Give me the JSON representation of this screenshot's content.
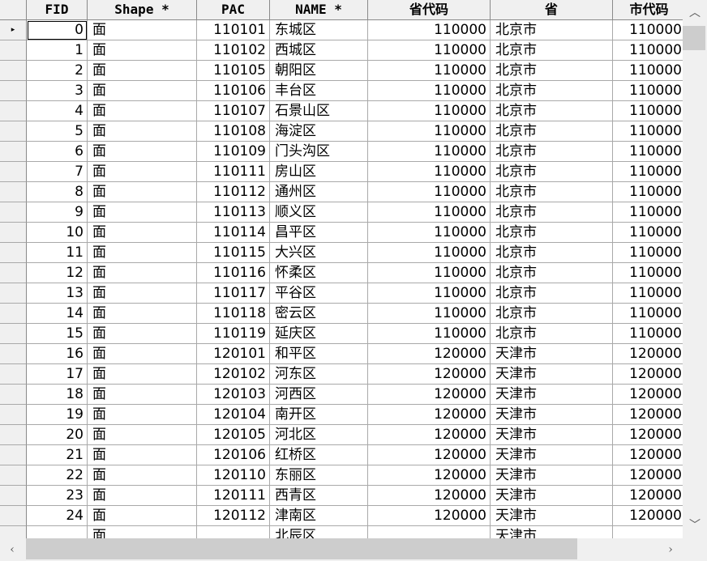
{
  "table": {
    "columns": [
      "FID",
      "Shape *",
      "PAC",
      "NAME *",
      "省代码",
      "省",
      "市代码"
    ],
    "rows": [
      {
        "fid": "0",
        "shape": "面",
        "pac": "110101",
        "name": "东城区",
        "prov_code": "110000",
        "prov": "北京市",
        "city_code": "110000"
      },
      {
        "fid": "1",
        "shape": "面",
        "pac": "110102",
        "name": "西城区",
        "prov_code": "110000",
        "prov": "北京市",
        "city_code": "110000"
      },
      {
        "fid": "2",
        "shape": "面",
        "pac": "110105",
        "name": "朝阳区",
        "prov_code": "110000",
        "prov": "北京市",
        "city_code": "110000"
      },
      {
        "fid": "3",
        "shape": "面",
        "pac": "110106",
        "name": "丰台区",
        "prov_code": "110000",
        "prov": "北京市",
        "city_code": "110000"
      },
      {
        "fid": "4",
        "shape": "面",
        "pac": "110107",
        "name": "石景山区",
        "prov_code": "110000",
        "prov": "北京市",
        "city_code": "110000"
      },
      {
        "fid": "5",
        "shape": "面",
        "pac": "110108",
        "name": "海淀区",
        "prov_code": "110000",
        "prov": "北京市",
        "city_code": "110000"
      },
      {
        "fid": "6",
        "shape": "面",
        "pac": "110109",
        "name": "门头沟区",
        "prov_code": "110000",
        "prov": "北京市",
        "city_code": "110000"
      },
      {
        "fid": "7",
        "shape": "面",
        "pac": "110111",
        "name": "房山区",
        "prov_code": "110000",
        "prov": "北京市",
        "city_code": "110000"
      },
      {
        "fid": "8",
        "shape": "面",
        "pac": "110112",
        "name": "通州区",
        "prov_code": "110000",
        "prov": "北京市",
        "city_code": "110000"
      },
      {
        "fid": "9",
        "shape": "面",
        "pac": "110113",
        "name": "顺义区",
        "prov_code": "110000",
        "prov": "北京市",
        "city_code": "110000"
      },
      {
        "fid": "10",
        "shape": "面",
        "pac": "110114",
        "name": "昌平区",
        "prov_code": "110000",
        "prov": "北京市",
        "city_code": "110000"
      },
      {
        "fid": "11",
        "shape": "面",
        "pac": "110115",
        "name": "大兴区",
        "prov_code": "110000",
        "prov": "北京市",
        "city_code": "110000"
      },
      {
        "fid": "12",
        "shape": "面",
        "pac": "110116",
        "name": "怀柔区",
        "prov_code": "110000",
        "prov": "北京市",
        "city_code": "110000"
      },
      {
        "fid": "13",
        "shape": "面",
        "pac": "110117",
        "name": "平谷区",
        "prov_code": "110000",
        "prov": "北京市",
        "city_code": "110000"
      },
      {
        "fid": "14",
        "shape": "面",
        "pac": "110118",
        "name": "密云区",
        "prov_code": "110000",
        "prov": "北京市",
        "city_code": "110000"
      },
      {
        "fid": "15",
        "shape": "面",
        "pac": "110119",
        "name": "延庆区",
        "prov_code": "110000",
        "prov": "北京市",
        "city_code": "110000"
      },
      {
        "fid": "16",
        "shape": "面",
        "pac": "120101",
        "name": "和平区",
        "prov_code": "120000",
        "prov": "天津市",
        "city_code": "120000"
      },
      {
        "fid": "17",
        "shape": "面",
        "pac": "120102",
        "name": "河东区",
        "prov_code": "120000",
        "prov": "天津市",
        "city_code": "120000"
      },
      {
        "fid": "18",
        "shape": "面",
        "pac": "120103",
        "name": "河西区",
        "prov_code": "120000",
        "prov": "天津市",
        "city_code": "120000"
      },
      {
        "fid": "19",
        "shape": "面",
        "pac": "120104",
        "name": "南开区",
        "prov_code": "120000",
        "prov": "天津市",
        "city_code": "120000"
      },
      {
        "fid": "20",
        "shape": "面",
        "pac": "120105",
        "name": "河北区",
        "prov_code": "120000",
        "prov": "天津市",
        "city_code": "120000"
      },
      {
        "fid": "21",
        "shape": "面",
        "pac": "120106",
        "name": "红桥区",
        "prov_code": "120000",
        "prov": "天津市",
        "city_code": "120000"
      },
      {
        "fid": "22",
        "shape": "面",
        "pac": "120110",
        "name": "东丽区",
        "prov_code": "120000",
        "prov": "天津市",
        "city_code": "120000"
      },
      {
        "fid": "23",
        "shape": "面",
        "pac": "120111",
        "name": "西青区",
        "prov_code": "120000",
        "prov": "天津市",
        "city_code": "120000"
      },
      {
        "fid": "24",
        "shape": "面",
        "pac": "120112",
        "name": "津南区",
        "prov_code": "120000",
        "prov": "天津市",
        "city_code": "120000"
      },
      {
        "fid": "",
        "shape": "面",
        "pac": "",
        "name": "北辰区",
        "prov_code": "",
        "prov": "天津市",
        "city_code": ""
      }
    ],
    "current_row_marker": "▸"
  },
  "scrollbars": {
    "up_icon": "chevron-up-icon",
    "down_icon": "chevron-down-icon",
    "left_icon": "chevron-left-icon",
    "right_icon": "chevron-right-icon",
    "up_glyph": "︿",
    "down_glyph": "﹀",
    "left_glyph": "‹",
    "right_glyph": "›"
  }
}
